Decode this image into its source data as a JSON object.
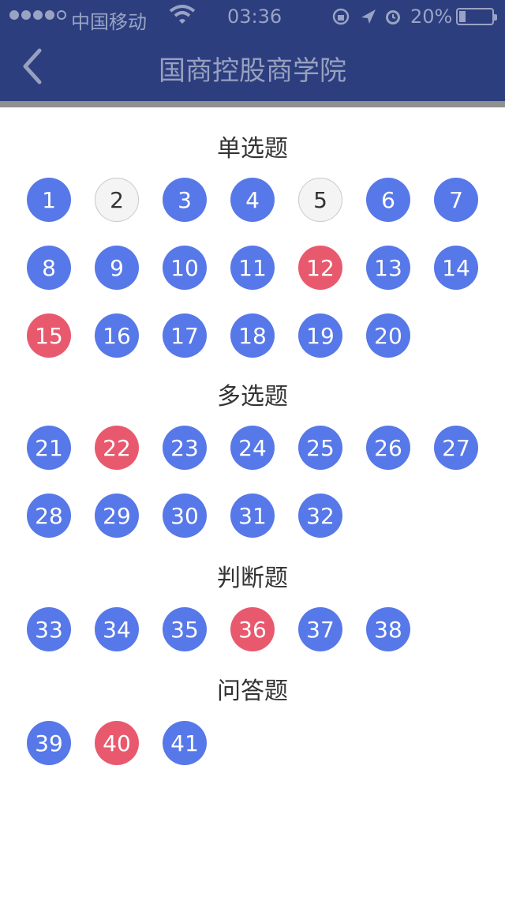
{
  "status": {
    "carrier": "中国移动",
    "time": "03:36",
    "battery": "20%"
  },
  "nav": {
    "title": "国商控股商学院"
  },
  "sections": [
    {
      "title": "单选题",
      "items": [
        {
          "n": "1",
          "state": "blue"
        },
        {
          "n": "2",
          "state": "blank"
        },
        {
          "n": "3",
          "state": "blue"
        },
        {
          "n": "4",
          "state": "blue"
        },
        {
          "n": "5",
          "state": "blank"
        },
        {
          "n": "6",
          "state": "blue"
        },
        {
          "n": "7",
          "state": "blue"
        },
        {
          "n": "8",
          "state": "blue"
        },
        {
          "n": "9",
          "state": "blue"
        },
        {
          "n": "10",
          "state": "blue"
        },
        {
          "n": "11",
          "state": "blue"
        },
        {
          "n": "12",
          "state": "red"
        },
        {
          "n": "13",
          "state": "blue"
        },
        {
          "n": "14",
          "state": "blue"
        },
        {
          "n": "15",
          "state": "red"
        },
        {
          "n": "16",
          "state": "blue"
        },
        {
          "n": "17",
          "state": "blue"
        },
        {
          "n": "18",
          "state": "blue"
        },
        {
          "n": "19",
          "state": "blue"
        },
        {
          "n": "20",
          "state": "blue"
        }
      ]
    },
    {
      "title": "多选题",
      "items": [
        {
          "n": "21",
          "state": "blue"
        },
        {
          "n": "22",
          "state": "red"
        },
        {
          "n": "23",
          "state": "blue"
        },
        {
          "n": "24",
          "state": "blue"
        },
        {
          "n": "25",
          "state": "blue"
        },
        {
          "n": "26",
          "state": "blue"
        },
        {
          "n": "27",
          "state": "blue"
        },
        {
          "n": "28",
          "state": "blue"
        },
        {
          "n": "29",
          "state": "blue"
        },
        {
          "n": "30",
          "state": "blue"
        },
        {
          "n": "31",
          "state": "blue"
        },
        {
          "n": "32",
          "state": "blue"
        }
      ]
    },
    {
      "title": "判断题",
      "items": [
        {
          "n": "33",
          "state": "blue"
        },
        {
          "n": "34",
          "state": "blue"
        },
        {
          "n": "35",
          "state": "blue"
        },
        {
          "n": "36",
          "state": "red"
        },
        {
          "n": "37",
          "state": "blue"
        },
        {
          "n": "38",
          "state": "blue"
        }
      ]
    },
    {
      "title": "问答题",
      "items": [
        {
          "n": "39",
          "state": "blue"
        },
        {
          "n": "40",
          "state": "red"
        },
        {
          "n": "41",
          "state": "blue"
        }
      ]
    }
  ],
  "colors": {
    "header": "#2c3e7e",
    "answered": "#5778e8",
    "wrong": "#e9596e",
    "unanswered": "#f4f4f4"
  }
}
